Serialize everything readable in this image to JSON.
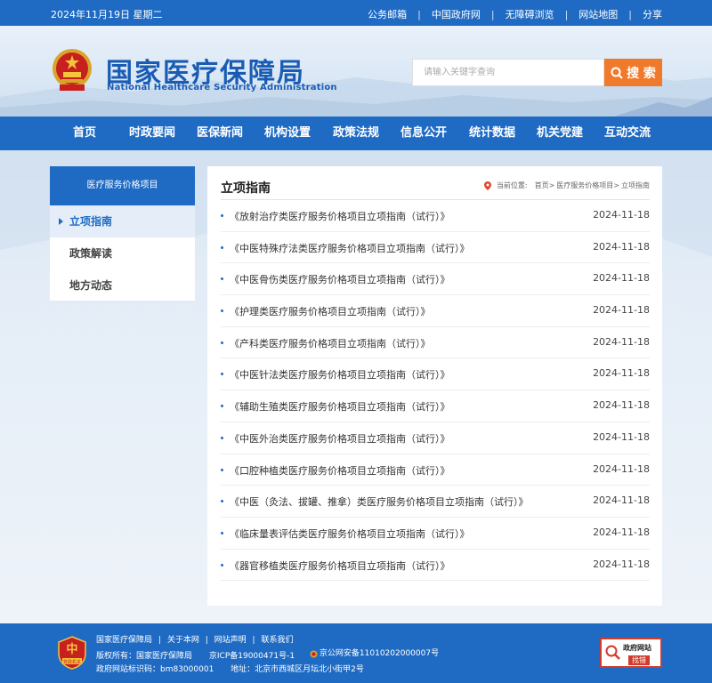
{
  "topbar": {
    "date": "2024年11月19日 星期二",
    "links": [
      "公务邮箱",
      "中国政府网",
      "无障碍浏览",
      "网站地图",
      "分享"
    ],
    "separator": "|"
  },
  "header": {
    "logo_cn": "国家医疗保障局",
    "logo_en": "National Healthcare Security Administration",
    "search_placeholder": "请输入关键字查询",
    "search_button": "搜 索",
    "search_icon": "magnifier-icon"
  },
  "nav": [
    "首页",
    "时政要闻",
    "医保新闻",
    "机构设置",
    "政策法规",
    "信息公开",
    "统计数据",
    "机关党建",
    "互动交流"
  ],
  "sidebar": {
    "heading": "医疗服务价格项目",
    "items": [
      {
        "label": "立项指南",
        "active": true
      },
      {
        "label": "政策解读",
        "active": false
      },
      {
        "label": "地方动态",
        "active": false
      }
    ]
  },
  "main": {
    "title": "立项指南",
    "breadcrumb_prefix": "当前位置:",
    "breadcrumb": [
      "首页>",
      "医疗服务价格项目>",
      "立项指南"
    ],
    "list": [
      {
        "title": "《放射治疗类医疗服务价格项目立项指南（试行）》",
        "date": "2024-11-18"
      },
      {
        "title": "《中医特殊疗法类医疗服务价格项目立项指南（试行）》",
        "date": "2024-11-18"
      },
      {
        "title": "《中医骨伤类医疗服务价格项目立项指南（试行）》",
        "date": "2024-11-18"
      },
      {
        "title": "《护理类医疗服务价格项目立项指南（试行）》",
        "date": "2024-11-18"
      },
      {
        "title": "《产科类医疗服务价格项目立项指南（试行）》",
        "date": "2024-11-18"
      },
      {
        "title": "《中医针法类医疗服务价格项目立项指南（试行）》",
        "date": "2024-11-18"
      },
      {
        "title": "《辅助生殖类医疗服务价格项目立项指南（试行）》",
        "date": "2024-11-18"
      },
      {
        "title": "《中医外治类医疗服务价格项目立项指南（试行）》",
        "date": "2024-11-18"
      },
      {
        "title": "《口腔种植类医疗服务价格项目立项指南（试行）》",
        "date": "2024-11-18"
      },
      {
        "title": "《中医（灸法、拔罐、推拿）类医疗服务价格项目立项指南（试行）》",
        "date": "2024-11-18"
      },
      {
        "title": "《临床量表评估类医疗服务价格项目立项指南（试行）》",
        "date": "2024-11-18"
      },
      {
        "title": "《器官移植类医疗服务价格项目立项指南（试行）》",
        "date": "2024-11-18"
      }
    ]
  },
  "footer": {
    "links": [
      "国家医疗保障局",
      "关于本网",
      "网站声明",
      "联系我们"
    ],
    "copyright": "版权所有：国家医疗保障局",
    "icp": "京ICP备19000471号-1",
    "police": "京公网安备11010202000007号",
    "site_code": "政府网站标识码：bm83000001",
    "address": "地址：北京市西城区月坛北小街甲2号",
    "badge_line1": "政府网站",
    "badge_line2": "找错",
    "party_badge_text": "党政机关"
  },
  "colors": {
    "primary": "#1f6bc4",
    "accent": "#f07a2c",
    "badge_red": "#d23a2a"
  }
}
